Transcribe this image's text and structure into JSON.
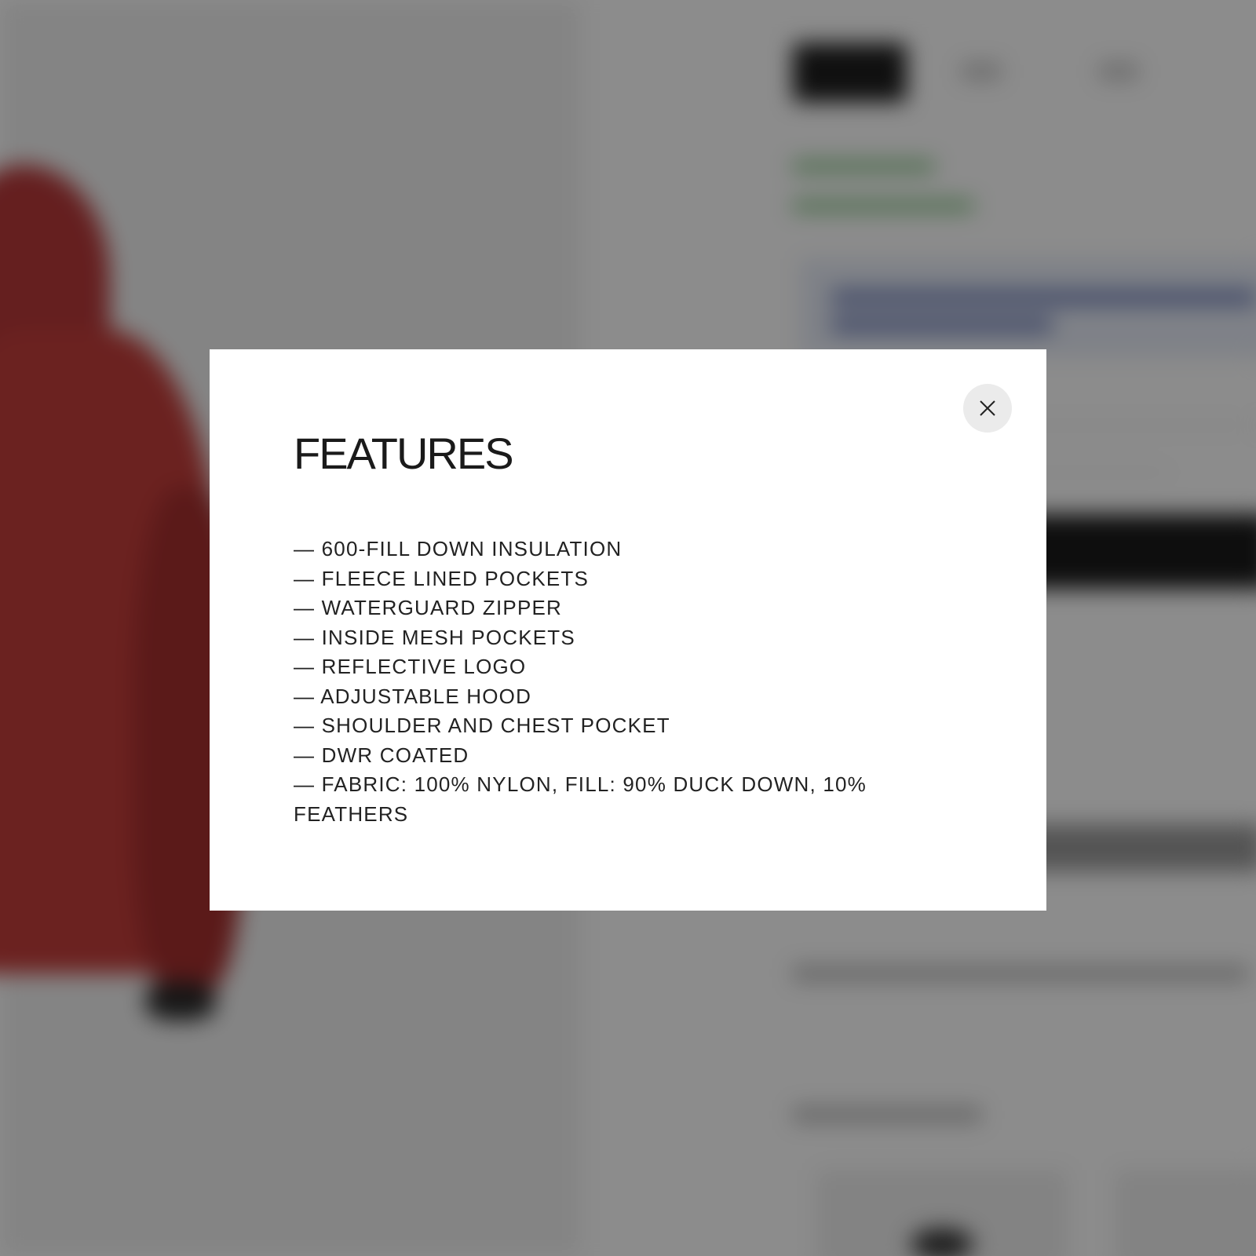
{
  "modal": {
    "title": "FEATURES",
    "close_icon": "close-icon",
    "features": [
      "— 600-FILL DOWN INSULATION",
      "— FLEECE LINED POCKETS",
      "— WATERGUARD ZIPPER",
      "— INSIDE MESH POCKETS",
      "— REFLECTIVE LOGO",
      "— ADJUSTABLE HOOD",
      "— SHOULDER AND CHEST POCKET",
      "— DWR COATED",
      "— FABRIC: 100% NYLON, FILL: 90% DUCK DOWN, 10% FEATHERS"
    ]
  },
  "colors": {
    "overlay": "#000000",
    "modal_background": "#ffffff",
    "text": "#222222",
    "close_button_background": "#ebebeb",
    "product_color": "#c43e3b"
  }
}
